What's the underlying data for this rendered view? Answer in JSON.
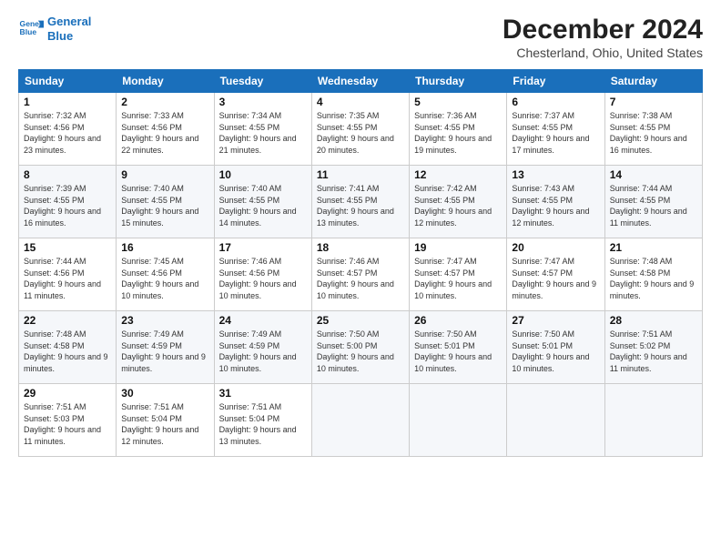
{
  "logo": {
    "line1": "General",
    "line2": "Blue"
  },
  "title": "December 2024",
  "subtitle": "Chesterland, Ohio, United States",
  "days_header": [
    "Sunday",
    "Monday",
    "Tuesday",
    "Wednesday",
    "Thursday",
    "Friday",
    "Saturday"
  ],
  "weeks": [
    [
      {
        "num": "1",
        "sunrise": "7:32 AM",
        "sunset": "4:56 PM",
        "daylight": "9 hours and 23 minutes."
      },
      {
        "num": "2",
        "sunrise": "7:33 AM",
        "sunset": "4:56 PM",
        "daylight": "9 hours and 22 minutes."
      },
      {
        "num": "3",
        "sunrise": "7:34 AM",
        "sunset": "4:55 PM",
        "daylight": "9 hours and 21 minutes."
      },
      {
        "num": "4",
        "sunrise": "7:35 AM",
        "sunset": "4:55 PM",
        "daylight": "9 hours and 20 minutes."
      },
      {
        "num": "5",
        "sunrise": "7:36 AM",
        "sunset": "4:55 PM",
        "daylight": "9 hours and 19 minutes."
      },
      {
        "num": "6",
        "sunrise": "7:37 AM",
        "sunset": "4:55 PM",
        "daylight": "9 hours and 17 minutes."
      },
      {
        "num": "7",
        "sunrise": "7:38 AM",
        "sunset": "4:55 PM",
        "daylight": "9 hours and 16 minutes."
      }
    ],
    [
      {
        "num": "8",
        "sunrise": "7:39 AM",
        "sunset": "4:55 PM",
        "daylight": "9 hours and 16 minutes."
      },
      {
        "num": "9",
        "sunrise": "7:40 AM",
        "sunset": "4:55 PM",
        "daylight": "9 hours and 15 minutes."
      },
      {
        "num": "10",
        "sunrise": "7:40 AM",
        "sunset": "4:55 PM",
        "daylight": "9 hours and 14 minutes."
      },
      {
        "num": "11",
        "sunrise": "7:41 AM",
        "sunset": "4:55 PM",
        "daylight": "9 hours and 13 minutes."
      },
      {
        "num": "12",
        "sunrise": "7:42 AM",
        "sunset": "4:55 PM",
        "daylight": "9 hours and 12 minutes."
      },
      {
        "num": "13",
        "sunrise": "7:43 AM",
        "sunset": "4:55 PM",
        "daylight": "9 hours and 12 minutes."
      },
      {
        "num": "14",
        "sunrise": "7:44 AM",
        "sunset": "4:55 PM",
        "daylight": "9 hours and 11 minutes."
      }
    ],
    [
      {
        "num": "15",
        "sunrise": "7:44 AM",
        "sunset": "4:56 PM",
        "daylight": "9 hours and 11 minutes."
      },
      {
        "num": "16",
        "sunrise": "7:45 AM",
        "sunset": "4:56 PM",
        "daylight": "9 hours and 10 minutes."
      },
      {
        "num": "17",
        "sunrise": "7:46 AM",
        "sunset": "4:56 PM",
        "daylight": "9 hours and 10 minutes."
      },
      {
        "num": "18",
        "sunrise": "7:46 AM",
        "sunset": "4:57 PM",
        "daylight": "9 hours and 10 minutes."
      },
      {
        "num": "19",
        "sunrise": "7:47 AM",
        "sunset": "4:57 PM",
        "daylight": "9 hours and 10 minutes."
      },
      {
        "num": "20",
        "sunrise": "7:47 AM",
        "sunset": "4:57 PM",
        "daylight": "9 hours and 9 minutes."
      },
      {
        "num": "21",
        "sunrise": "7:48 AM",
        "sunset": "4:58 PM",
        "daylight": "9 hours and 9 minutes."
      }
    ],
    [
      {
        "num": "22",
        "sunrise": "7:48 AM",
        "sunset": "4:58 PM",
        "daylight": "9 hours and 9 minutes."
      },
      {
        "num": "23",
        "sunrise": "7:49 AM",
        "sunset": "4:59 PM",
        "daylight": "9 hours and 9 minutes."
      },
      {
        "num": "24",
        "sunrise": "7:49 AM",
        "sunset": "4:59 PM",
        "daylight": "9 hours and 10 minutes."
      },
      {
        "num": "25",
        "sunrise": "7:50 AM",
        "sunset": "5:00 PM",
        "daylight": "9 hours and 10 minutes."
      },
      {
        "num": "26",
        "sunrise": "7:50 AM",
        "sunset": "5:01 PM",
        "daylight": "9 hours and 10 minutes."
      },
      {
        "num": "27",
        "sunrise": "7:50 AM",
        "sunset": "5:01 PM",
        "daylight": "9 hours and 10 minutes."
      },
      {
        "num": "28",
        "sunrise": "7:51 AM",
        "sunset": "5:02 PM",
        "daylight": "9 hours and 11 minutes."
      }
    ],
    [
      {
        "num": "29",
        "sunrise": "7:51 AM",
        "sunset": "5:03 PM",
        "daylight": "9 hours and 11 minutes."
      },
      {
        "num": "30",
        "sunrise": "7:51 AM",
        "sunset": "5:04 PM",
        "daylight": "9 hours and 12 minutes."
      },
      {
        "num": "31",
        "sunrise": "7:51 AM",
        "sunset": "5:04 PM",
        "daylight": "9 hours and 13 minutes."
      },
      null,
      null,
      null,
      null
    ]
  ]
}
